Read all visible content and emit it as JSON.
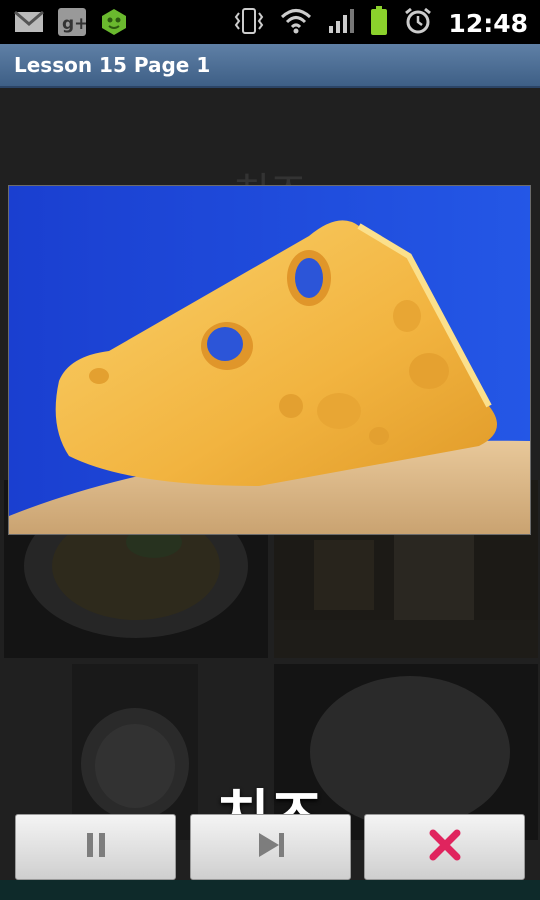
{
  "status_bar": {
    "time": "12:48",
    "icons": [
      "gmail-icon",
      "google-plus-icon",
      "app-notification-icon",
      "vibrate-icon",
      "wifi-icon",
      "signal-icon",
      "battery-icon",
      "alarm-icon"
    ]
  },
  "title_bar": {
    "title": "Lesson 15 Page 1"
  },
  "background_word": "치즈",
  "word_label": "치즈",
  "controls": [
    {
      "name": "pause-button",
      "icon": "pause-icon"
    },
    {
      "name": "next-button",
      "icon": "skip-next-icon"
    },
    {
      "name": "close-button",
      "icon": "close-icon"
    }
  ],
  "colors": {
    "title_bar": "#4d6f96",
    "close_icon": "#e0245e",
    "image_background": "#1f49d6",
    "cheese": "#f2b440"
  }
}
